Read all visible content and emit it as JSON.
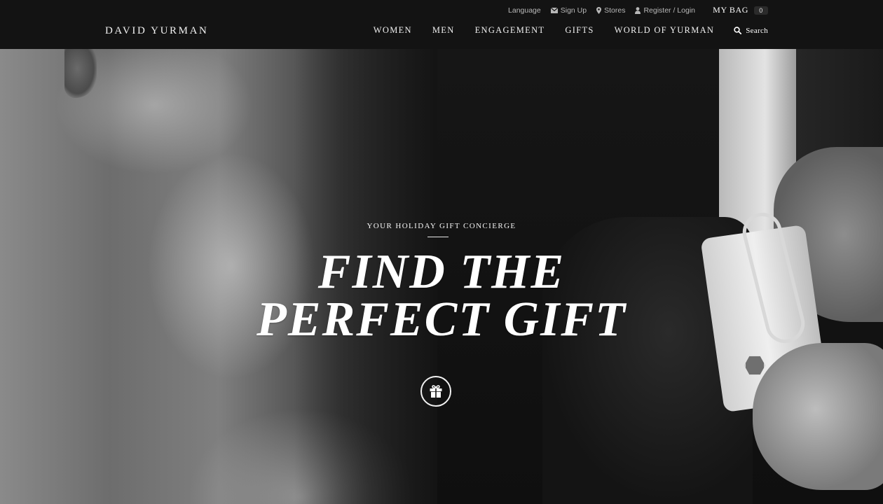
{
  "header": {
    "logo": "DAVID YURMAN",
    "utility": {
      "language": "Language",
      "sign_up": "Sign Up",
      "stores": "Stores",
      "register_login": "Register / Login"
    },
    "bag": {
      "label": "MY BAG",
      "count": "0"
    },
    "nav": [
      "WOMEN",
      "MEN",
      "ENGAGEMENT",
      "GIFTS",
      "WORLD OF YURMAN"
    ],
    "search_label": "Search"
  },
  "hero": {
    "eyebrow": "YOUR HOLIDAY GIFT CONCIERGE",
    "headline_line1": "FIND THE",
    "headline_line2": "PERFECT GIFT",
    "cta_icon": "gift-icon"
  },
  "colors": {
    "header_bg": "#131313",
    "text": "#ffffff",
    "utility_text": "#b8b8b8"
  }
}
